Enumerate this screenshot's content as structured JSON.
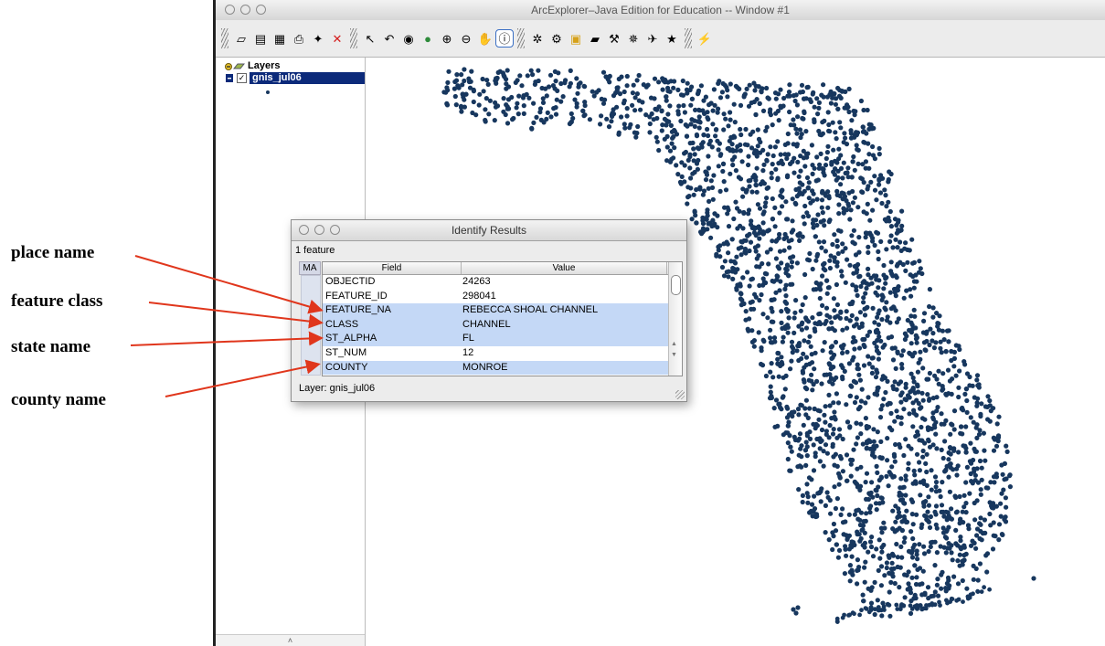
{
  "annotations": [
    {
      "label": "place name"
    },
    {
      "label": "feature class"
    },
    {
      "label": "state name"
    },
    {
      "label": "county name"
    }
  ],
  "app": {
    "title": "ArcExplorer–Java Edition for Education -- Window #1"
  },
  "toolbar": {
    "groups": [
      [
        {
          "icon": "new-map-icon",
          "glyph": "▱"
        },
        {
          "icon": "open-map-icon",
          "glyph": "▤"
        },
        {
          "icon": "save-map-icon",
          "glyph": "▦"
        },
        {
          "icon": "print-icon",
          "glyph": "⎙"
        },
        {
          "icon": "add-layer-icon",
          "glyph": "✦"
        },
        {
          "icon": "delete-layer-icon",
          "glyph": "✕",
          "color": "#d41c1c"
        }
      ],
      [
        {
          "icon": "select-arrow-icon",
          "glyph": "↖"
        },
        {
          "icon": "zoom-previous-icon",
          "glyph": "↶"
        },
        {
          "icon": "zoom-layer-icon",
          "glyph": "◉"
        },
        {
          "icon": "full-extent-icon",
          "glyph": "●",
          "color": "#2e8b3b"
        },
        {
          "icon": "zoom-in-icon",
          "glyph": "⊕"
        },
        {
          "icon": "zoom-out-icon",
          "glyph": "⊖"
        },
        {
          "icon": "pan-hand-icon",
          "glyph": "✋"
        },
        {
          "icon": "identify-icon",
          "glyph": "ⓘ",
          "active": true
        }
      ],
      [
        {
          "icon": "find-icon",
          "glyph": "✲"
        },
        {
          "icon": "query-icon",
          "glyph": "⚙"
        },
        {
          "icon": "select-features-icon",
          "glyph": "▣",
          "color": "#d6a11a"
        },
        {
          "icon": "clear-selection-icon",
          "glyph": "▰"
        },
        {
          "icon": "measure-icon",
          "glyph": "⚒"
        },
        {
          "icon": "buffer-icon",
          "glyph": "✵"
        },
        {
          "icon": "geocode-icon",
          "glyph": "✈"
        },
        {
          "icon": "hotlink-icon",
          "glyph": "★"
        }
      ],
      [
        {
          "icon": "lightning-icon",
          "glyph": "⚡",
          "color": "#d6a11a"
        }
      ]
    ]
  },
  "layers_panel": {
    "header": "Layers",
    "layer_name": "gnis_jul06",
    "checked": true,
    "scroll_glyph": "˄"
  },
  "map": {
    "point_color": "#17375e"
  },
  "identify": {
    "title": "Identify Results",
    "feature_count": "1 feature",
    "ma_label": "MA",
    "columns": {
      "field": "Field",
      "value": "Value"
    },
    "rows": [
      {
        "field": "OBJECTID",
        "value": "24263",
        "highlight": false
      },
      {
        "field": "FEATURE_ID",
        "value": "298041",
        "highlight": false
      },
      {
        "field": "FEATURE_NA",
        "value": "REBECCA SHOAL CHANNEL",
        "highlight": true
      },
      {
        "field": "CLASS",
        "value": "CHANNEL",
        "highlight": true
      },
      {
        "field": "ST_ALPHA",
        "value": "FL",
        "highlight": true
      },
      {
        "field": "ST_NUM",
        "value": "12",
        "highlight": false
      },
      {
        "field": "COUNTY",
        "value": "MONROE",
        "highlight": true
      }
    ],
    "layer_footer": "Layer: gnis_jul06"
  }
}
